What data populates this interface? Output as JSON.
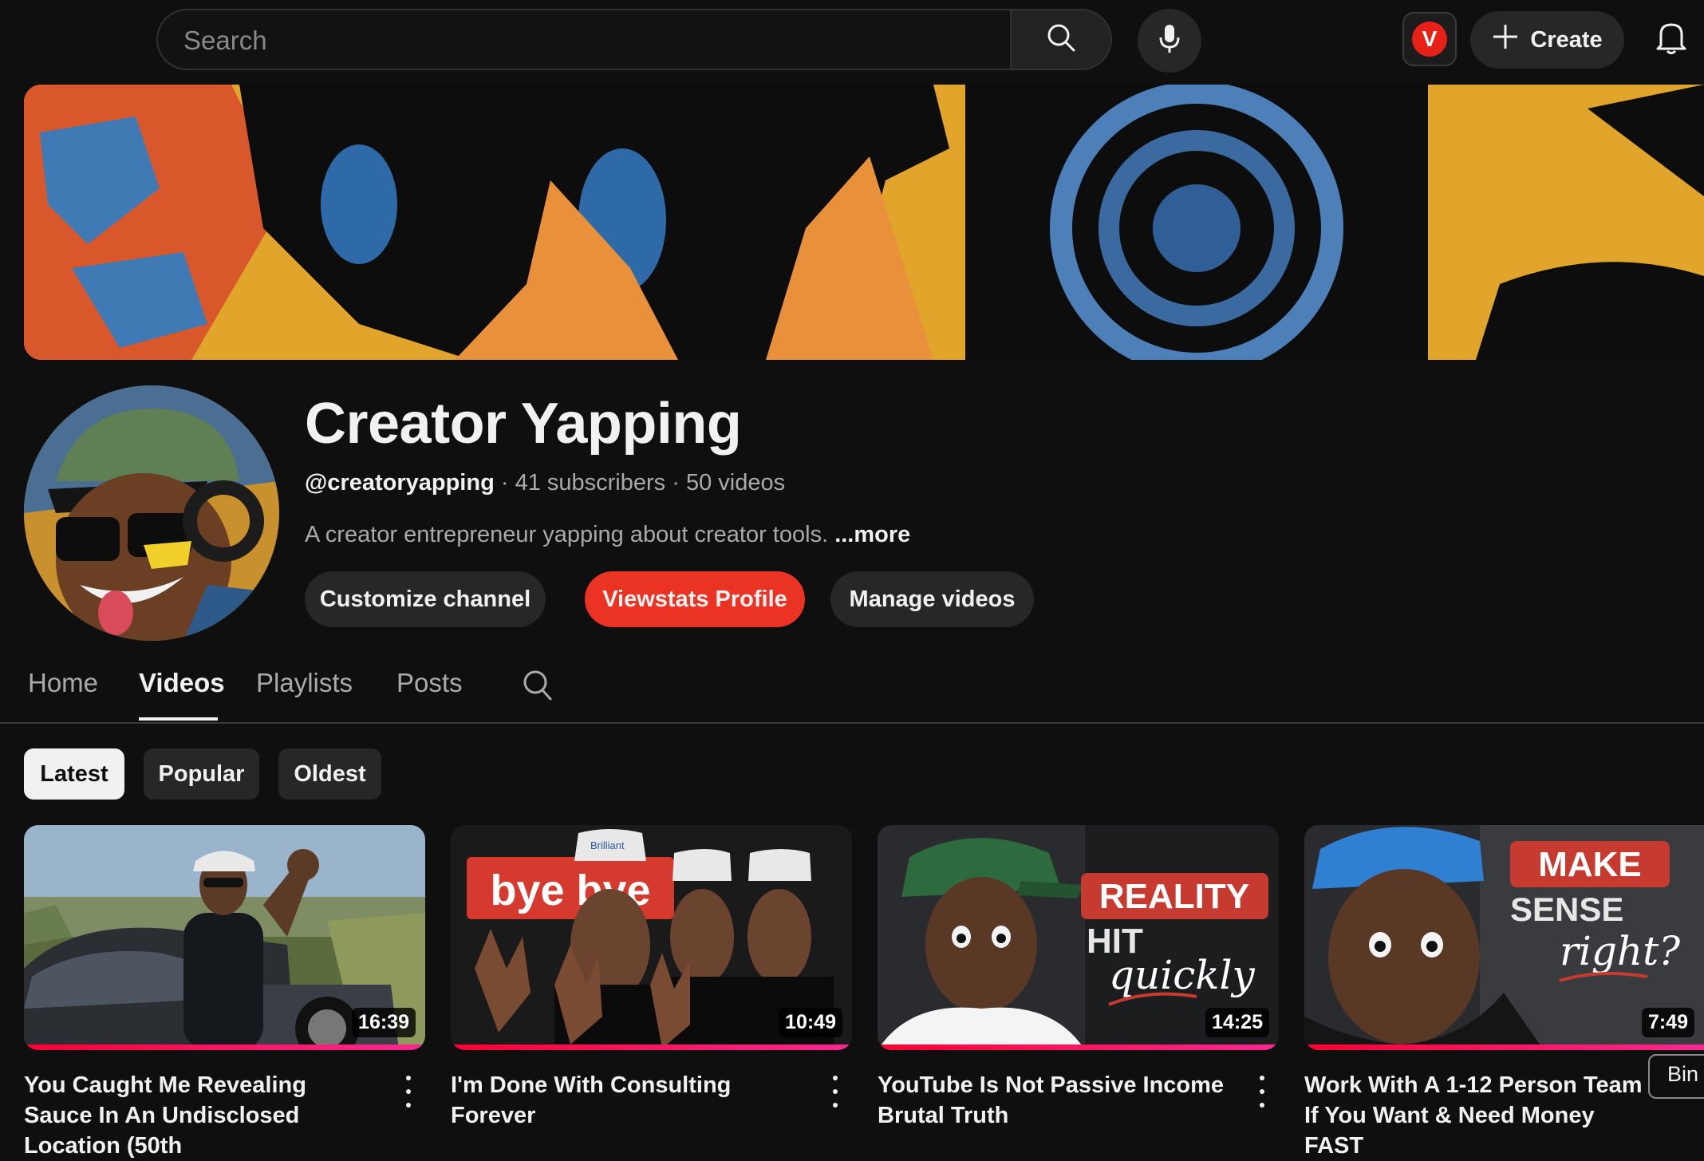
{
  "header": {
    "search_placeholder": "Search",
    "extension_letter": "V",
    "create_label": "Create"
  },
  "channel": {
    "name": "Creator Yapping",
    "handle": "@creatoryapping",
    "subscribers": "41 subscribers",
    "videos": "50 videos",
    "separator": "·",
    "description": "A creator entrepreneur yapping about creator tools.",
    "more_label": "...more"
  },
  "actions": {
    "customize": "Customize channel",
    "viewstats": "Viewstats Profile",
    "manage": "Manage videos"
  },
  "tabs": [
    {
      "label": "Home"
    },
    {
      "label": "Videos",
      "active": true
    },
    {
      "label": "Playlists"
    },
    {
      "label": "Posts"
    }
  ],
  "chips": [
    {
      "label": "Latest",
      "active": true
    },
    {
      "label": "Popular"
    },
    {
      "label": "Oldest"
    }
  ],
  "videos": [
    {
      "title": "You Caught Me Revealing Sauce In An Undisclosed Location (50th",
      "duration": "16:39",
      "watched_fraction": 1.0
    },
    {
      "title": "I'm Done With Consulting Forever",
      "duration": "10:49",
      "watched_fraction": 1.0
    },
    {
      "title": "YouTube Is Not Passive Income Brutal Truth",
      "duration": "14:25",
      "watched_fraction": 1.0
    },
    {
      "title": "Work With A 1-12 Person Team If You Want & Need Money FAST",
      "duration": "7:49",
      "watched_fraction": 1.0
    }
  ],
  "thumb_text": {
    "v2_overlay": "bye bye",
    "v2_cap": "Brilliant",
    "v3_overlay_1": "REALITY",
    "v3_overlay_2": "HIT",
    "v3_overlay_3": "quickly",
    "v4_overlay_1": "MAKE",
    "v4_overlay_2": "SENSE",
    "v4_overlay_3": "right?"
  },
  "tooltip": "Bin",
  "colors": {
    "background": "#0f0f0f",
    "accent_red": "#e62117",
    "viewstats_red": "#ea3323",
    "chip_active": "#f1f1f1"
  }
}
